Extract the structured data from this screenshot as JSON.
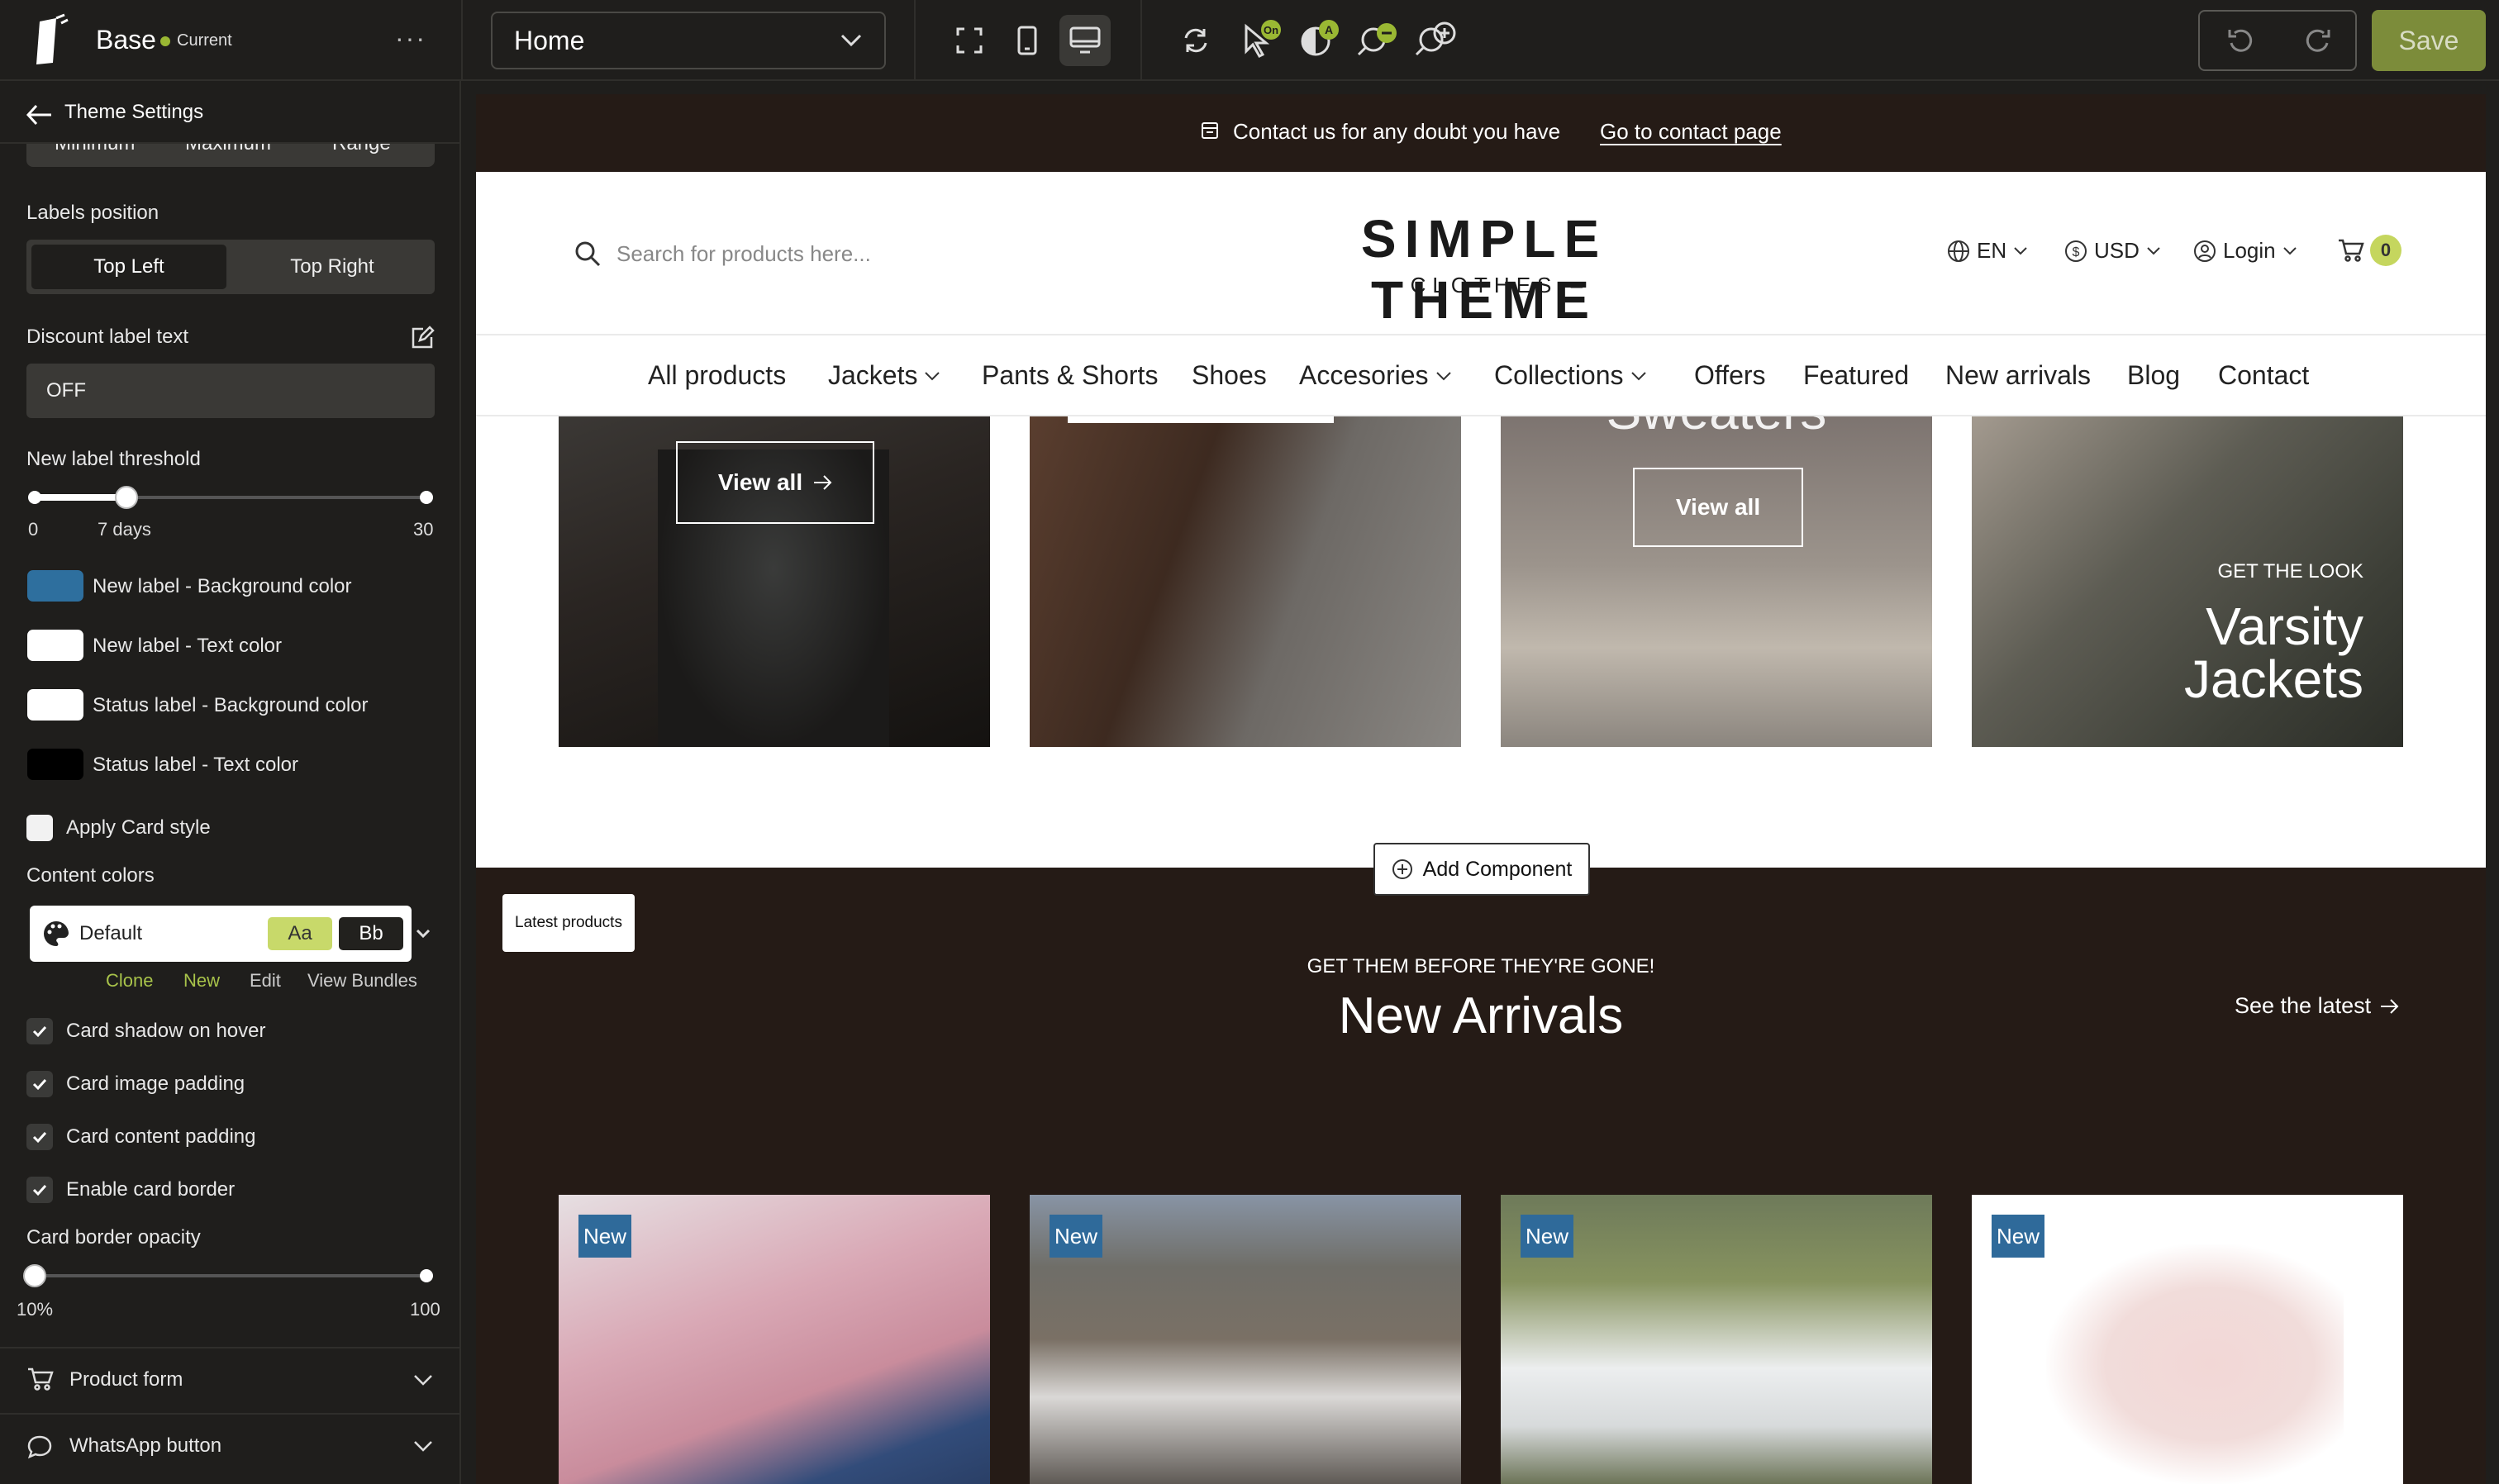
{
  "app": {
    "name": "Base",
    "status": "Current"
  },
  "toolbar": {
    "page_select": "Home",
    "save_label": "Save"
  },
  "sidebar": {
    "back_label": "Theme Settings",
    "range_tabs": [
      "Minimum",
      "Maximum",
      "Range"
    ],
    "labels_position": {
      "label": "Labels position",
      "options": [
        "Top Left",
        "Top Right"
      ],
      "selected": "Top Left"
    },
    "discount": {
      "label": "Discount label text",
      "value": "OFF"
    },
    "threshold": {
      "label": "New label threshold",
      "min": "0",
      "max": "30",
      "current": "7 days",
      "value": 7,
      "range_min": 0,
      "range_max": 30
    },
    "colors": [
      {
        "label": "New label - Background color",
        "color": "#2e6f9e"
      },
      {
        "label": "New label - Text color",
        "color": "#ffffff"
      },
      {
        "label": "Status label - Background color",
        "color": "#ffffff"
      },
      {
        "label": "Status label - Text color",
        "color": "#000000"
      }
    ],
    "apply_card": {
      "label": "Apply Card style",
      "checked": false
    },
    "content_colors": {
      "label": "Content colors",
      "palette": "Default",
      "aa": "Aa",
      "bb": "Bb",
      "actions": [
        "Clone",
        "New",
        "Edit",
        "View Bundles"
      ]
    },
    "checks": [
      {
        "label": "Card shadow on hover",
        "checked": true
      },
      {
        "label": "Card image padding",
        "checked": true
      },
      {
        "label": "Card content padding",
        "checked": true
      },
      {
        "label": "Enable card border",
        "checked": true
      }
    ],
    "border_opacity": {
      "label": "Card border opacity",
      "min": "10%",
      "max": "100",
      "value": 10
    },
    "sections": [
      {
        "label": "Product form",
        "icon": "cart-icon"
      },
      {
        "label": "WhatsApp button",
        "icon": "chat-icon"
      }
    ]
  },
  "store": {
    "announcement": {
      "text": "Contact us for any doubt you have",
      "link": "Go to contact page"
    },
    "search_placeholder": "Search for products here...",
    "logo": {
      "title": "SIMPLE THEME",
      "subtitle": "– CLOTHES –"
    },
    "lang": "EN",
    "currency": "USD",
    "login": "Login",
    "cart_count": "0",
    "nav": [
      "All products",
      "Jackets",
      "Pants & Shorts",
      "Shoes",
      "Accesories",
      "Collections",
      "Offers",
      "Featured",
      "New arrivals",
      "Blog",
      "Contact"
    ],
    "banners": {
      "view_all_1": "View all",
      "heading_3": "Sweaters",
      "view_all_3": "View all",
      "look_kicker": "GET THE LOOK",
      "look_title_1": "Varsity",
      "look_title_2": "Jackets"
    },
    "add_component": "Add Component",
    "section_tag": "Latest products",
    "arrivals": {
      "kicker": "GET THEM BEFORE THEY'RE GONE!",
      "title": "New Arrivals",
      "see_latest": "See the latest"
    },
    "product_badge": "New"
  }
}
